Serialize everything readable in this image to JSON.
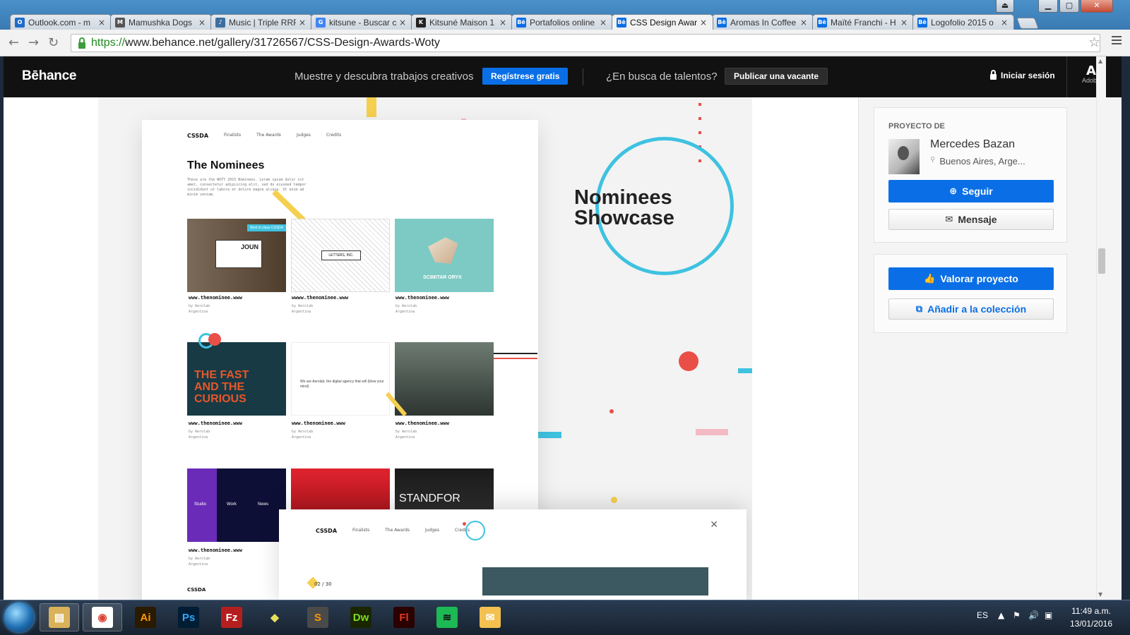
{
  "browser": {
    "tabs": [
      {
        "label": "Outlook.com - m",
        "fav": "O",
        "color": "#1e6bc9"
      },
      {
        "label": "Mamushka Dogs",
        "fav": "M",
        "color": "#555555"
      },
      {
        "label": "Music | Triple RRR",
        "fav": "♪",
        "color": "#3c6fa0"
      },
      {
        "label": "kitsune - Buscar c",
        "fav": "G",
        "color": "#4285f4"
      },
      {
        "label": "Kitsuné Maison 1",
        "fav": "K",
        "color": "#222222"
      },
      {
        "label": "Portafolios online",
        "fav": "Bē",
        "color": "#0a6fe6"
      },
      {
        "label": "CSS Design Awar",
        "fav": "Bē",
        "color": "#0a6fe6",
        "active": true
      },
      {
        "label": "Aromas In Coffee",
        "fav": "Bē",
        "color": "#0a6fe6"
      },
      {
        "label": "Maïté Franchi - H",
        "fav": "Bē",
        "color": "#0a6fe6"
      },
      {
        "label": "Logofolio 2015 o",
        "fav": "Bē",
        "color": "#0a6fe6"
      }
    ],
    "url_scheme": "https://",
    "url_rest": "www.behance.net/gallery/31726567/CSS-Design-Awards-Woty",
    "window_controls": {
      "back": "⏏",
      "minimize": "▁",
      "maximize": "▢",
      "close": "✕"
    }
  },
  "behance": {
    "logo": "Bēhance",
    "tagline": "Muestre y descubra trabajos creativos",
    "signup": "Regístrese gratis",
    "talent": "¿En busca de talentos?",
    "post_job": "Publicar una vacante",
    "login": "Iniciar sesión",
    "adobe": "Adobe",
    "adobe_glyph": "A"
  },
  "project": {
    "mock_nav": {
      "logo": "CSSDA",
      "items": [
        "Finalists",
        "The Awards",
        "Judges",
        "Credits"
      ]
    },
    "title": "The Nominees",
    "desc": "These are the WOTY 2015 Nominees. Lorem ipsum dolor sit amet, consectetur adipiscing elit, sed do eiusmod tempor incididunt ut labore et dolore magna aliqua. Ut enim ad minim veniam.",
    "tile_url": "www.thenominee.www",
    "tile_url_alt": "wwww.thenominee.www",
    "tile_by": "by Aerolab",
    "tile_country": "Argentina",
    "tile_texts": {
      "best_in_class": "Best in class  CSSDA",
      "joun": "JOUN",
      "letters": "LETTERS, INC.",
      "scimitar": "SCIMITAR ORYX",
      "fast_curious": "THE FAST AND THE CURIOUS",
      "aerolab_line": "We are Aerolab, the digital agency that will (blow your mind)",
      "standfor": "STANDFOR",
      "studio": "Studio",
      "work": "Work",
      "news": "News"
    },
    "showcase_line1": "Nominees",
    "showcase_line2": "Showcase",
    "modal": {
      "logo": "CSSDA",
      "items": [
        "Finalists",
        "The Awards",
        "Judges",
        "Credits"
      ],
      "close": "✕",
      "pager": "02 / 30"
    },
    "footer_logo": "CSSDA"
  },
  "sidebar": {
    "owner_label": "PROYECTO DE",
    "owner_name": "Mercedes Bazan",
    "owner_location": "Buenos Aires, Arge...",
    "follow": "Seguir",
    "message": "Mensaje",
    "appreciate": "Valorar proyecto",
    "add_collection": "Añadir a la colección"
  },
  "taskbar": {
    "apps": [
      {
        "name": "explorer",
        "label": "▤",
        "bg": "#d9b25a",
        "fg": "#fff"
      },
      {
        "name": "chrome",
        "label": "◉",
        "bg": "#ffffff",
        "fg": "#db4437"
      },
      {
        "name": "illustrator",
        "label": "Ai",
        "bg": "#2a1a00",
        "fg": "#ff9a00"
      },
      {
        "name": "photoshop",
        "label": "Ps",
        "bg": "#001d34",
        "fg": "#31a8ff"
      },
      {
        "name": "filezilla",
        "label": "Fz",
        "bg": "#b51e1e",
        "fg": "#ffffff"
      },
      {
        "name": "sketchup",
        "label": "◆",
        "bg": "transparent",
        "fg": "#e8e05a"
      },
      {
        "name": "sublime",
        "label": "S",
        "bg": "#4a4a4a",
        "fg": "#ff9800"
      },
      {
        "name": "dreamweaver",
        "label": "Dw",
        "bg": "#1a2600",
        "fg": "#7ddc1f"
      },
      {
        "name": "flash",
        "label": "Fl",
        "bg": "#2a0000",
        "fg": "#e03a1e"
      },
      {
        "name": "spotify",
        "label": "≋",
        "bg": "#1db954",
        "fg": "#111"
      },
      {
        "name": "outlook-app",
        "label": "✉",
        "bg": "#f4c150",
        "fg": "#fff"
      }
    ],
    "lang": "ES",
    "time": "11:49 a.m.",
    "date": "13/01/2016"
  }
}
